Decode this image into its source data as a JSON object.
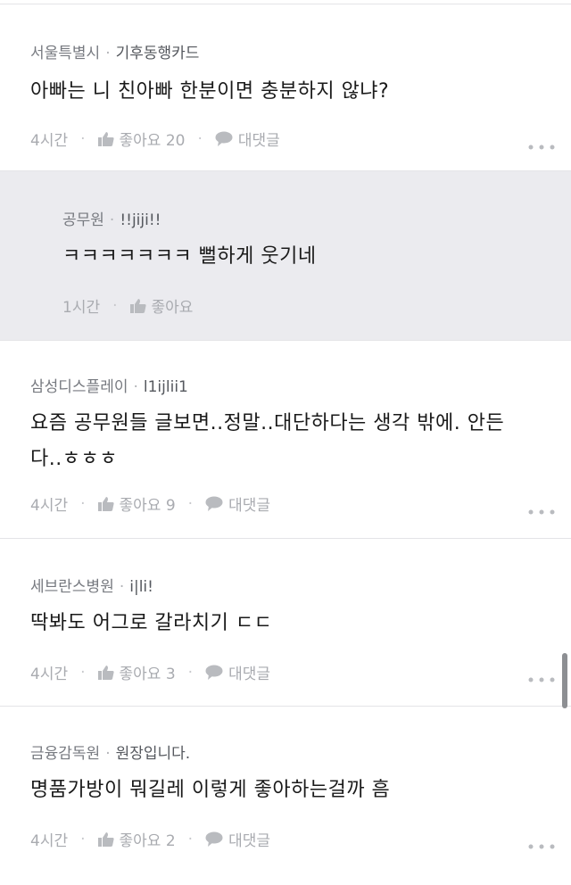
{
  "comments": [
    {
      "name": "서울특별시",
      "nick": "기후동행카드",
      "text": "아빠는 니 친아빠 한분이면 충분하지 않냐?",
      "time": "4시간",
      "like": "좋아요 20",
      "reply": "대댓글"
    },
    {
      "name": "공무원",
      "nick": "!!jiji!!",
      "text": "ㅋㅋㅋㅋㅋㅋㅋ 뻘하게 웃기네",
      "time": "1시간",
      "like": "좋아요"
    },
    {
      "name": "삼성디스플레이",
      "nick": "l1ijlii1",
      "text_line1": "요즘 공무원들 글보면..정말..대단하다는 생각 밖에. 안든",
      "text_line2": "다..ㅎㅎㅎ",
      "time": "4시간",
      "like": "좋아요 9",
      "reply": "대댓글"
    },
    {
      "name": "세브란스병원",
      "nick": "i|li!",
      "text": "딱봐도 어그로 갈라치기 ㄷㄷ",
      "time": "4시간",
      "like": "좋아요 3",
      "reply": "대댓글"
    },
    {
      "name": "금융감독원",
      "nick": "원장입니다.",
      "text": "명품가방이 뭐길레 이렇게 좋아하는걸까 흠",
      "time": "4시간",
      "like": "좋아요 2",
      "reply": "대댓글"
    }
  ],
  "icons": {
    "like": "thumbs-up-icon",
    "reply": "speech-bubble-icon",
    "more": "more-dots-icon"
  },
  "colors": {
    "reply_bg": "#ebebef",
    "meta": "#a9abb0"
  }
}
